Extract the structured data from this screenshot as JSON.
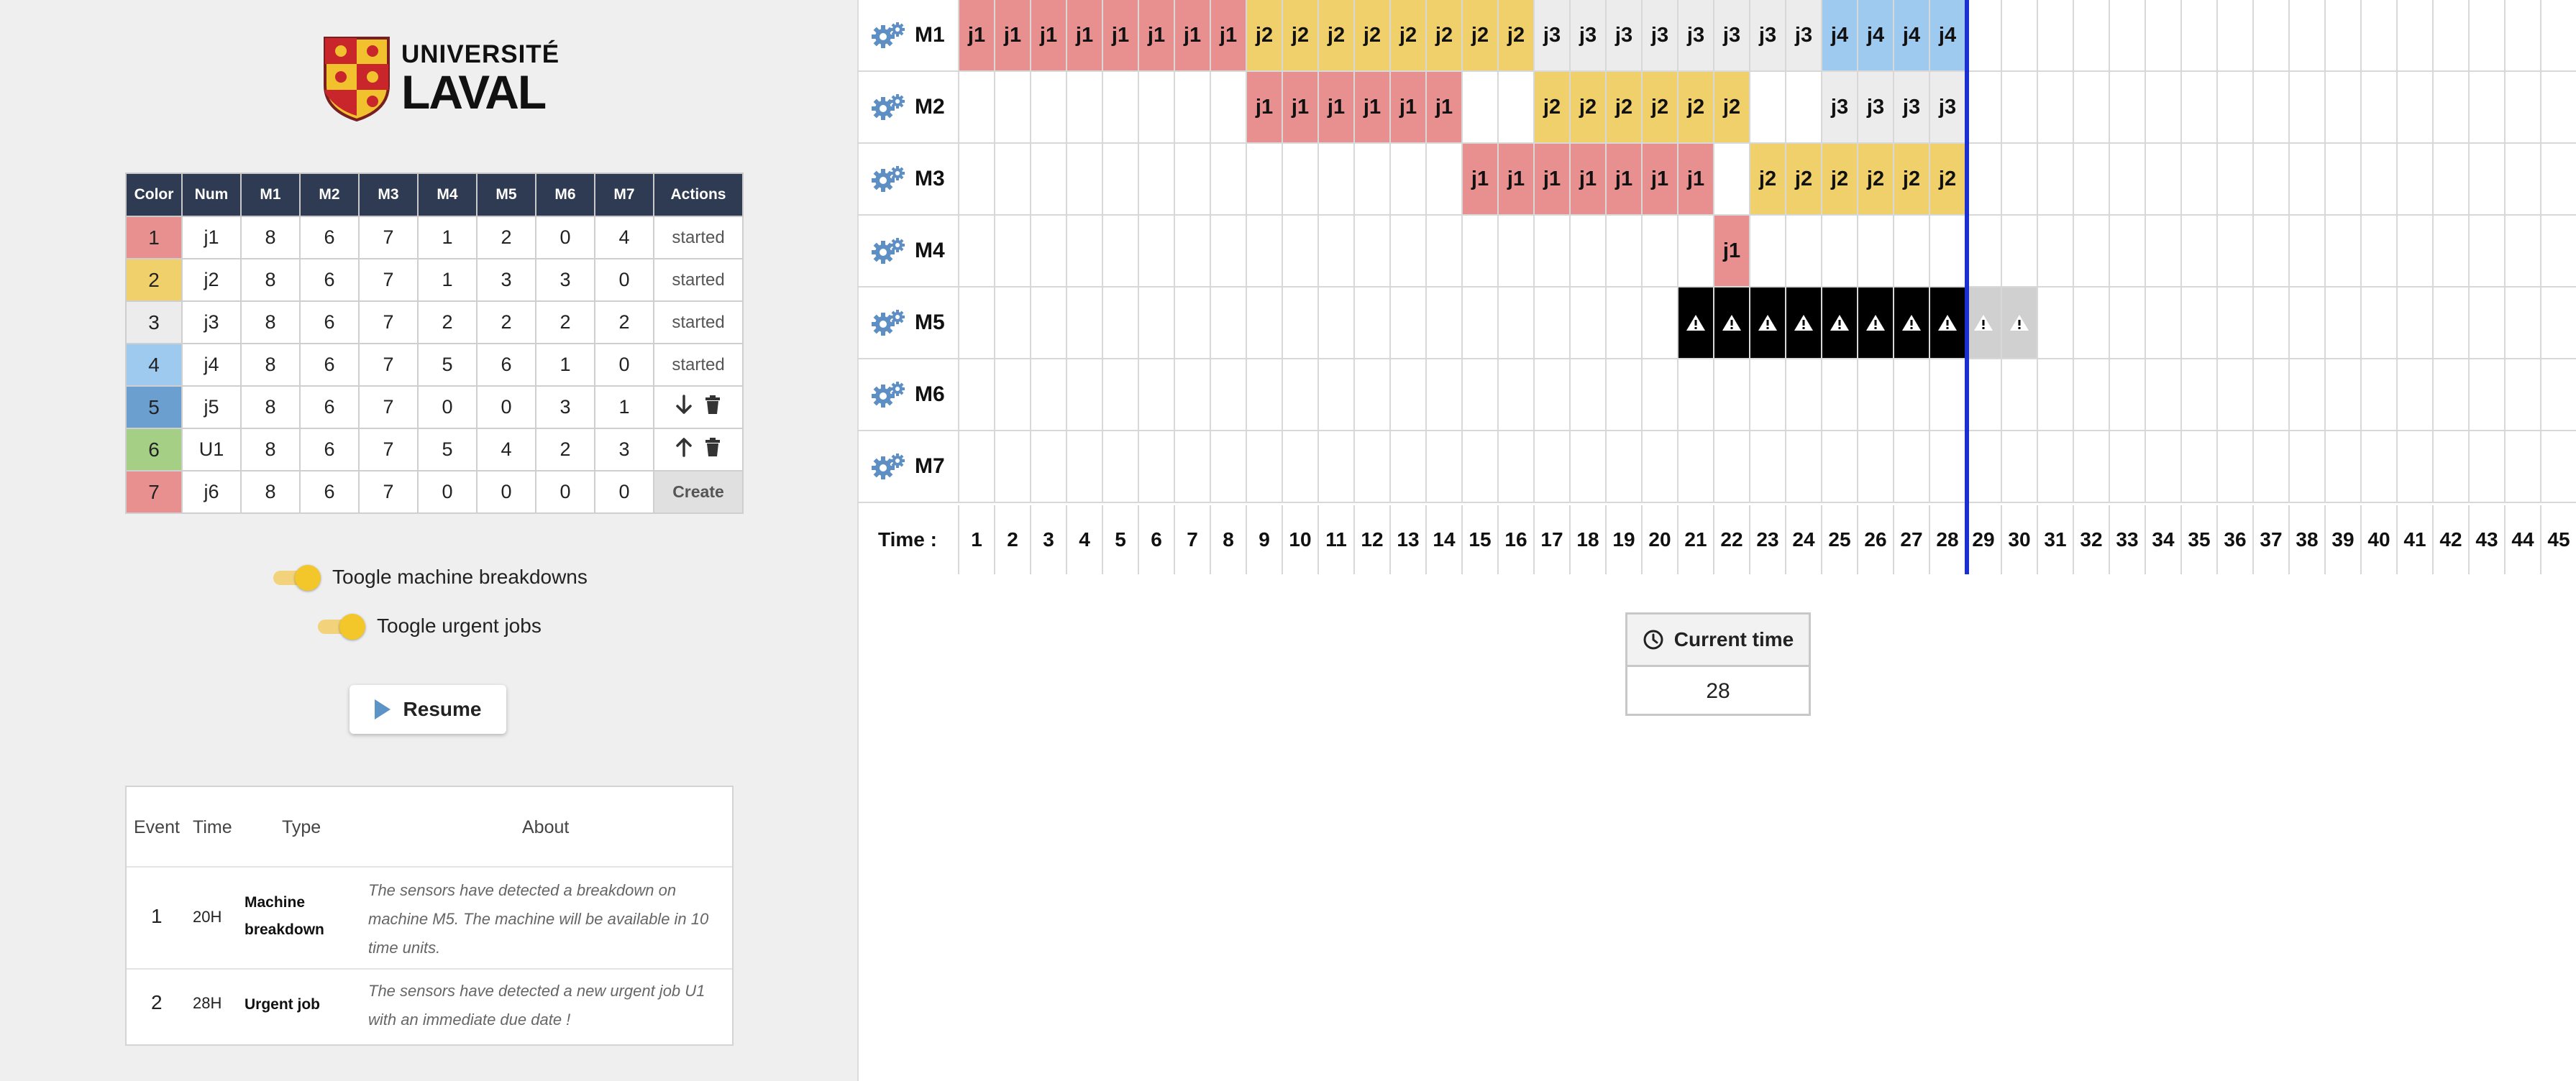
{
  "logo": {
    "line1": "UNIVERSITÉ",
    "line2": "LAVAL"
  },
  "job_table": {
    "headers": [
      "Color",
      "Num",
      "M1",
      "M2",
      "M3",
      "M4",
      "M5",
      "M6",
      "M7",
      "Actions"
    ],
    "rows": [
      {
        "color_index": "1",
        "color": "#e8908f",
        "num": "j1",
        "vals": [
          "8",
          "6",
          "7",
          "1",
          "2",
          "0",
          "4"
        ],
        "action": "started"
      },
      {
        "color_index": "2",
        "color": "#f0d06a",
        "num": "j2",
        "vals": [
          "8",
          "6",
          "7",
          "1",
          "3",
          "3",
          "0"
        ],
        "action": "started"
      },
      {
        "color_index": "3",
        "color": "#ececec",
        "num": "j3",
        "vals": [
          "8",
          "6",
          "7",
          "2",
          "2",
          "2",
          "2"
        ],
        "action": "started"
      },
      {
        "color_index": "4",
        "color": "#9fcaf0",
        "num": "j4",
        "vals": [
          "8",
          "6",
          "7",
          "5",
          "6",
          "1",
          "0"
        ],
        "action": "started"
      },
      {
        "color_index": "5",
        "color": "#6a9fd0",
        "num": "j5",
        "vals": [
          "8",
          "6",
          "7",
          "0",
          "0",
          "3",
          "1"
        ],
        "action_icons": [
          "arrow-down-icon",
          "trash-icon"
        ]
      },
      {
        "color_index": "6",
        "color": "#a5cf85",
        "num": "U1",
        "vals": [
          "8",
          "6",
          "7",
          "5",
          "4",
          "2",
          "3"
        ],
        "action_icons": [
          "arrow-up-icon",
          "trash-icon"
        ]
      },
      {
        "color_index": "7",
        "color": "#e8908f",
        "num": "j6",
        "vals": [
          "8",
          "6",
          "7",
          "0",
          "0",
          "0",
          "0"
        ],
        "action_button": "Create"
      }
    ]
  },
  "toggles": [
    {
      "label": "Toogle machine breakdowns",
      "on": true
    },
    {
      "label": "Toogle urgent jobs",
      "on": true
    }
  ],
  "resume_button": "Resume",
  "events": {
    "headers": [
      "Event",
      "Time",
      "Type",
      "About"
    ],
    "rows": [
      {
        "num": "1",
        "time": "20H",
        "type": "Machine breakdown",
        "about": "The sensors have detected a breakdown on machine M5. The machine will be available in 10 time units."
      },
      {
        "num": "2",
        "time": "28H",
        "type": "Urgent job",
        "about": "The sensors have detected a new urgent job U1 with an immediate due date !"
      }
    ]
  },
  "gantt": {
    "machines": [
      "M1",
      "M2",
      "M3",
      "M4",
      "M5",
      "M6",
      "M7"
    ],
    "time_label": "Time :",
    "time_units": [
      "1",
      "2",
      "3",
      "4",
      "5",
      "6",
      "7",
      "8",
      "9",
      "10",
      "11",
      "12",
      "13",
      "14",
      "15",
      "16",
      "17",
      "18",
      "19",
      "20",
      "21",
      "22",
      "23",
      "24",
      "25",
      "26",
      "27",
      "28",
      "29",
      "30",
      "31",
      "32",
      "33",
      "34",
      "35",
      "36",
      "37",
      "38",
      "39",
      "40",
      "41",
      "42",
      "43",
      "44",
      "45"
    ],
    "current_time_marker": 28,
    "colors": {
      "j1": "#e8908f",
      "j2": "#f0d06a",
      "j3": "#ececec",
      "j4": "#9fcaf0",
      "breakdown": "#000000",
      "breakdown_future": "#d0d0d0"
    },
    "schedule": {
      "M1": [
        {
          "job": "j1",
          "start": 1,
          "end": 8
        },
        {
          "job": "j2",
          "start": 9,
          "end": 16
        },
        {
          "job": "j3",
          "start": 17,
          "end": 24
        },
        {
          "job": "j4",
          "start": 25,
          "end": 28
        }
      ],
      "M2": [
        {
          "job": "j1",
          "start": 9,
          "end": 14
        },
        {
          "job": "j2",
          "start": 17,
          "end": 22
        },
        {
          "job": "j3",
          "start": 25,
          "end": 28
        }
      ],
      "M3": [
        {
          "job": "j1",
          "start": 15,
          "end": 21
        },
        {
          "job": "j2",
          "start": 23,
          "end": 28
        }
      ],
      "M4": [
        {
          "job": "j1",
          "start": 22,
          "end": 22
        }
      ],
      "M5": [
        {
          "job": "breakdown",
          "start": 21,
          "end": 28
        },
        {
          "job": "breakdown_future",
          "start": 29,
          "end": 30
        }
      ],
      "M6": [],
      "M7": []
    }
  },
  "current_time": {
    "label": "Current time",
    "value": "28"
  }
}
